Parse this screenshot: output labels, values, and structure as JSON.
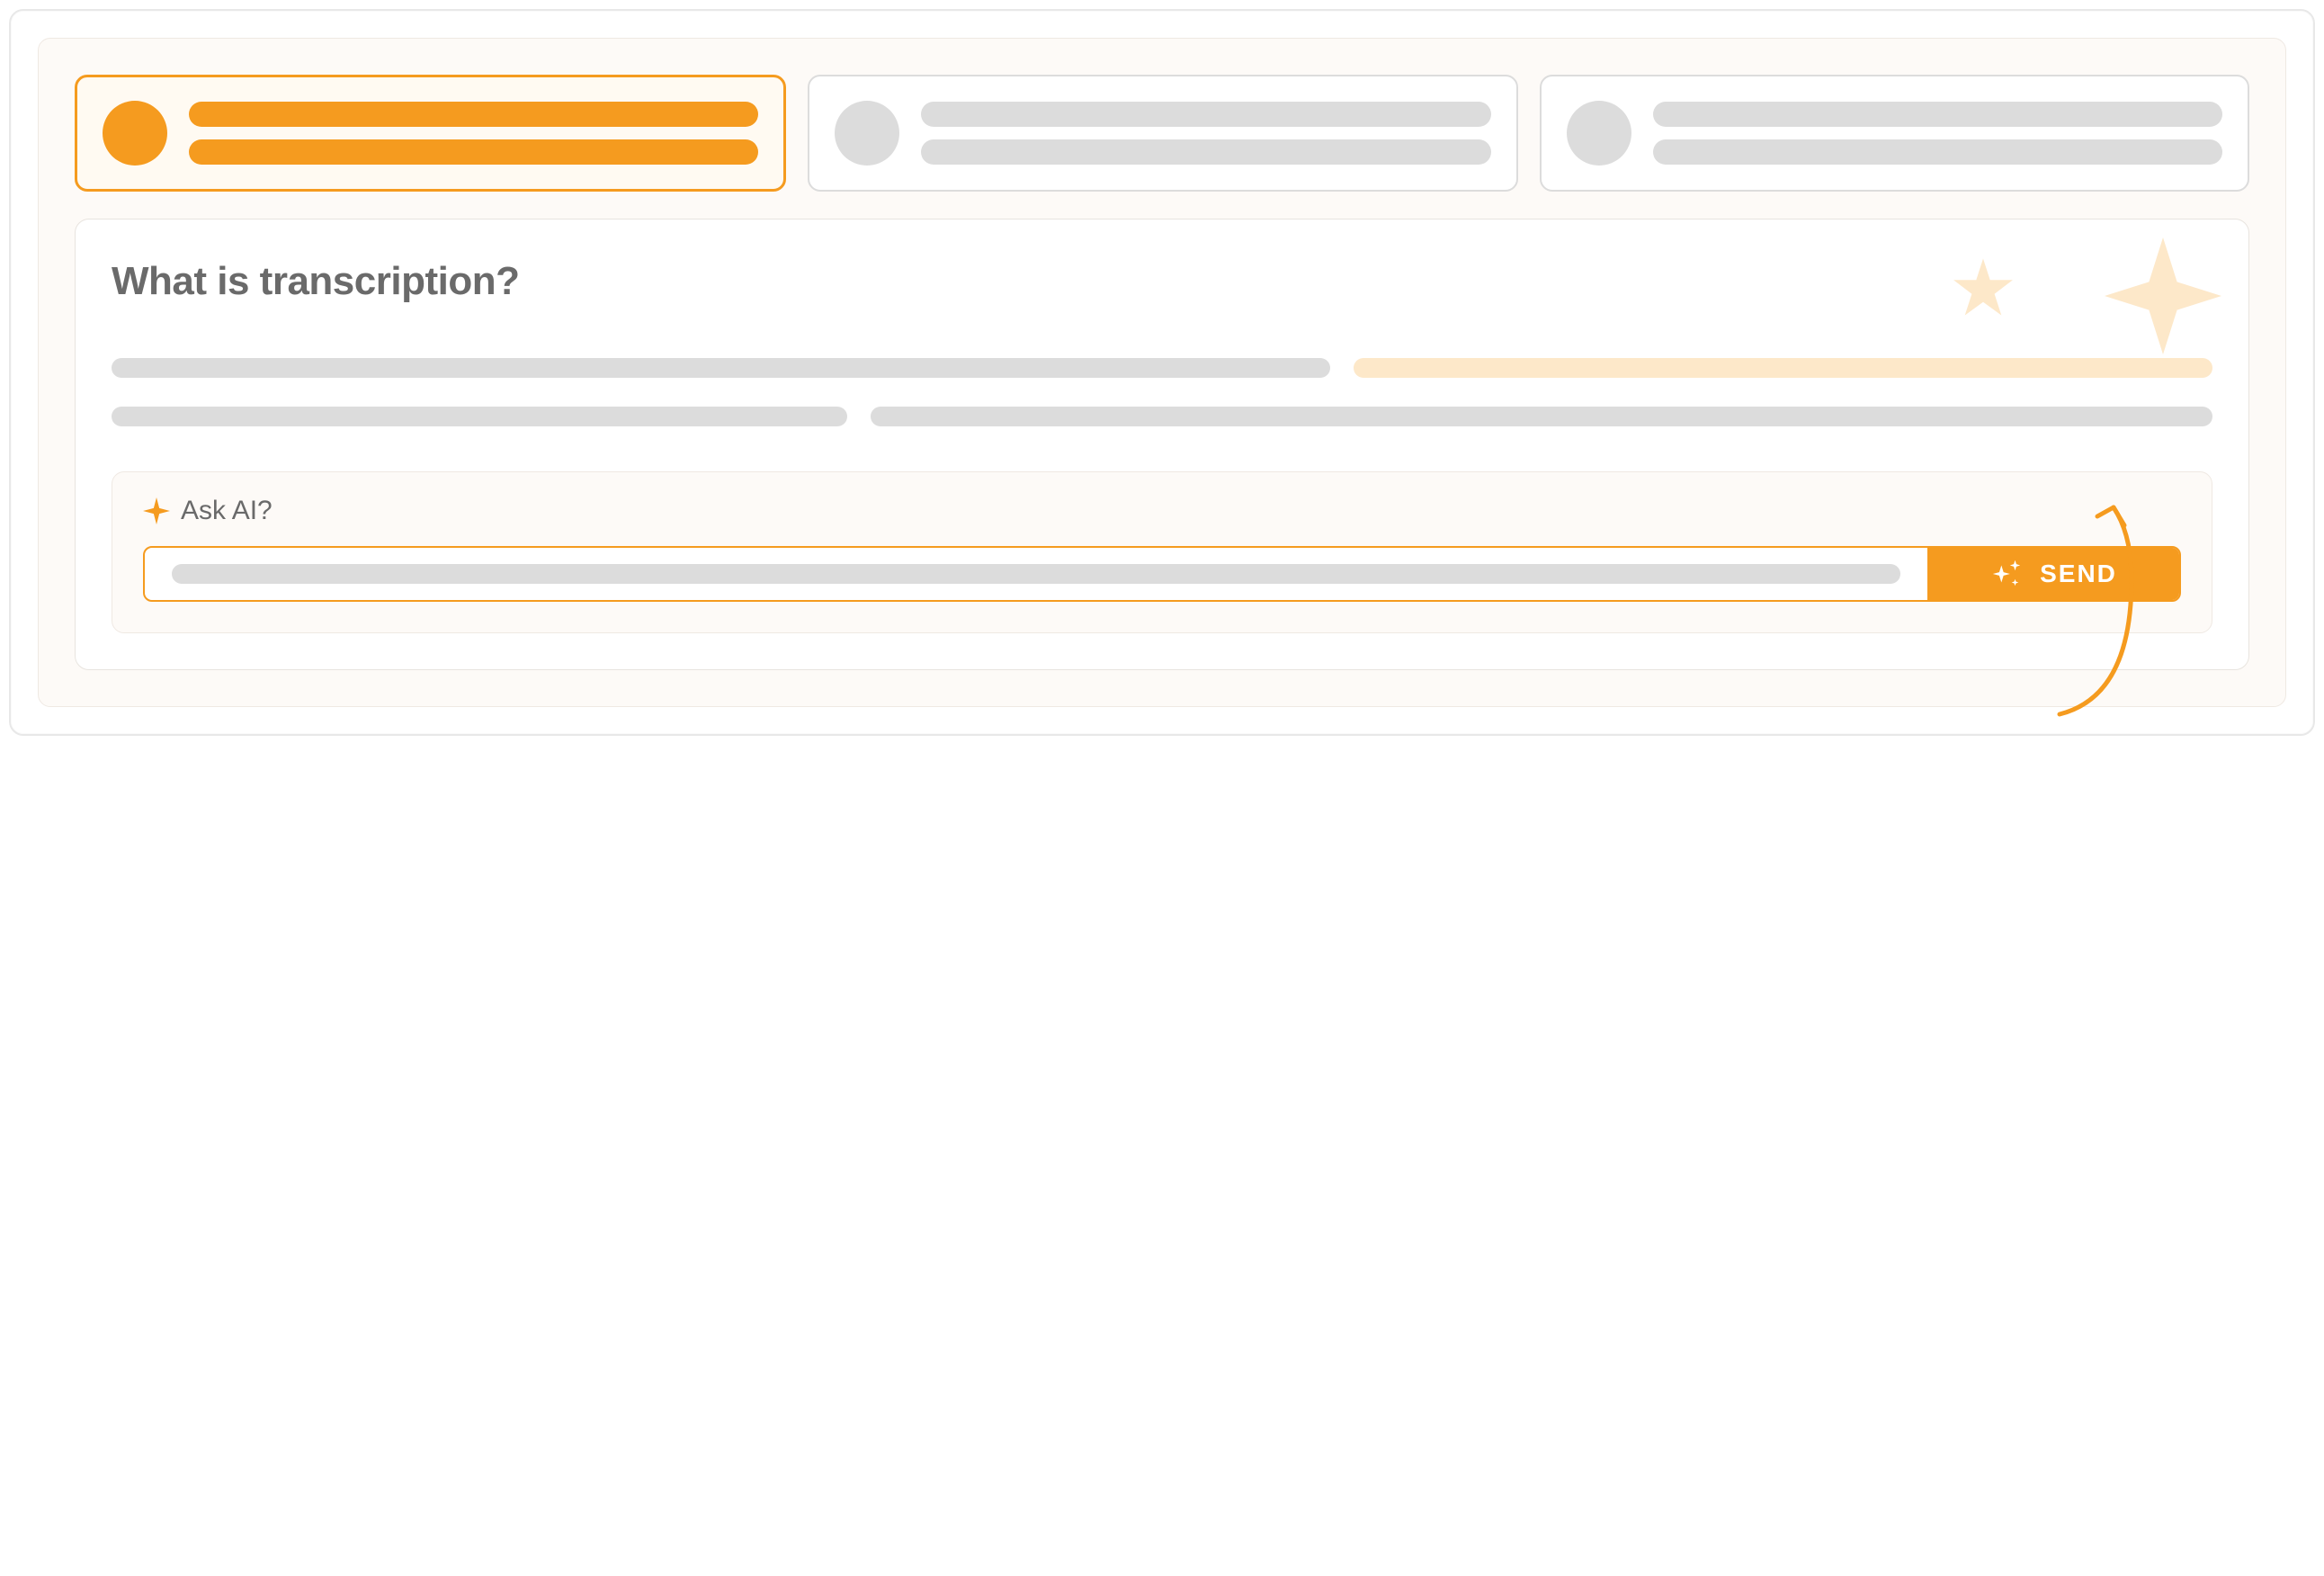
{
  "tabs": [
    {
      "active": true
    },
    {
      "active": false
    },
    {
      "active": false
    }
  ],
  "content": {
    "title": "What is transcription?"
  },
  "ask": {
    "label": "Ask AI?",
    "send_label": "SEND"
  },
  "colors": {
    "accent": "#f59b1f",
    "peach_light": "#fde8c9",
    "gray_placeholder": "#dcdcdc",
    "text_gray": "#6a6a6a",
    "bg_cream": "#fdfaf7"
  },
  "icons": {
    "sparkle_small": "sparkle-icon",
    "sparkle_cluster": "sparkle-cluster-icon",
    "star_small": "star-icon",
    "star_large": "star-icon"
  }
}
